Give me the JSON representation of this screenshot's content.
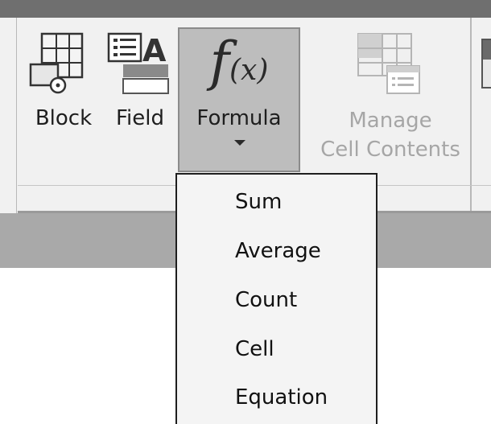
{
  "ribbon": {
    "buttons": [
      {
        "id": "block",
        "label": "Block",
        "icon": "insert-block-icon"
      },
      {
        "id": "field",
        "label": "Field",
        "icon": "insert-field-icon"
      },
      {
        "id": "formula",
        "label": "Formula",
        "icon": "formula-fx-icon",
        "icon_text": "f",
        "icon_text_paren": "(x)",
        "state": "pressed"
      },
      {
        "id": "manage",
        "label_line1": "Manage",
        "label_line2": "Cell Contents",
        "icon": "manage-cell-contents-icon",
        "state": "disabled"
      }
    ]
  },
  "formula_menu": {
    "items": [
      "Sum",
      "Average",
      "Count",
      "Cell",
      "Equation"
    ]
  }
}
